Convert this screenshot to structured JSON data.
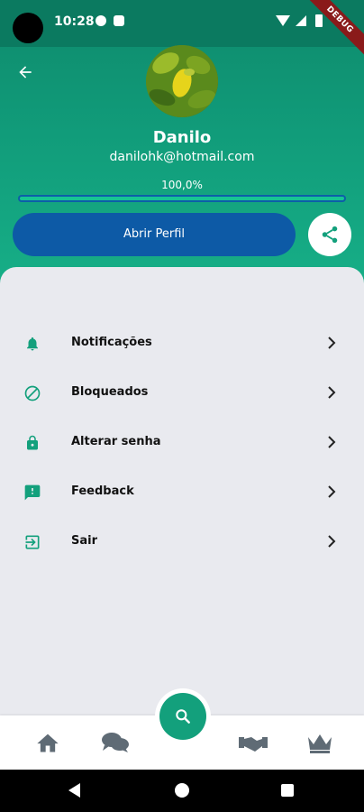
{
  "status_bar": {
    "time": "10:28",
    "debug_label": "DEBUG"
  },
  "profile": {
    "name": "Danilo",
    "email": "danilohk@hotmail.com",
    "progress_text": "100,0%",
    "progress_value": 1.0,
    "open_profile_label": "Abrir Perfil"
  },
  "menu": {
    "items": [
      {
        "label": "Notificações",
        "icon": "bell-icon"
      },
      {
        "label": "Bloqueados",
        "icon": "block-icon"
      },
      {
        "label": "Alterar senha",
        "icon": "lock-icon"
      },
      {
        "label": "Feedback",
        "icon": "feedback-icon"
      },
      {
        "label": "Sair",
        "icon": "exit-icon"
      }
    ]
  },
  "bottom_nav": {
    "items": [
      "home-icon",
      "chat-icon",
      "search-icon",
      "handshake-icon",
      "crown-icon"
    ]
  },
  "colors": {
    "primary": "#13a07c",
    "header_dark": "#0b7a60",
    "button_blue": "#0d5aa6",
    "menu_bg": "#e9eaef",
    "nav_icon_gray": "#5f6b75"
  }
}
